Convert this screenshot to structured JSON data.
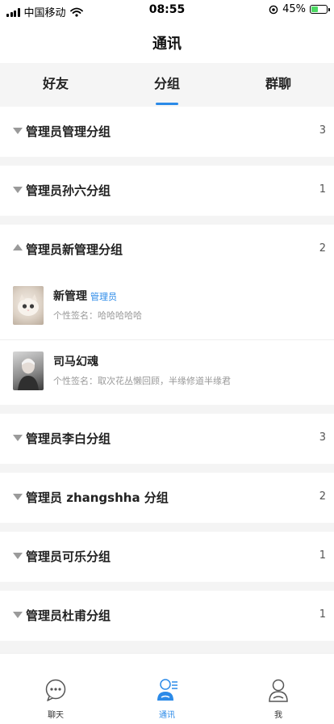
{
  "status_bar": {
    "carrier": "中国移动",
    "time": "08:55",
    "battery": "45%",
    "battery_level": 0.45,
    "icons": [
      "signal-icon",
      "wifi-icon",
      "location-icon",
      "battery-icon"
    ]
  },
  "header": {
    "title": "通讯"
  },
  "tabs": [
    {
      "label": "好友",
      "active": false
    },
    {
      "label": "分组",
      "active": true
    },
    {
      "label": "群聊",
      "active": false
    }
  ],
  "groups": [
    {
      "name": "管理员管理分组",
      "count": "3",
      "expanded": false
    },
    {
      "name": "管理员孙六分组",
      "count": "1",
      "expanded": false
    },
    {
      "name": "管理员新管理分组",
      "count": "2",
      "expanded": true,
      "members": [
        {
          "name": "新管理",
          "badge": "管理员",
          "signature": "个性签名：哈哈哈哈哈"
        },
        {
          "name": "司马幻魂",
          "badge": "",
          "signature": "个性签名：取次花丛懒回顾，半缘修道半缘君"
        }
      ]
    },
    {
      "name": "管理员李白分组",
      "count": "3",
      "expanded": false
    },
    {
      "name": "管理员 zhangshha 分组",
      "count": "2",
      "expanded": false
    },
    {
      "name": "管理员可乐分组",
      "count": "1",
      "expanded": false
    },
    {
      "name": "管理员杜甫分组",
      "count": "1",
      "expanded": false
    }
  ],
  "tab_bar": [
    {
      "label": "聊天",
      "icon": "chat-icon",
      "active": false
    },
    {
      "label": "通讯",
      "icon": "contacts-icon",
      "active": true
    },
    {
      "label": "我",
      "icon": "profile-icon",
      "active": false
    }
  ],
  "colors": {
    "accent": "#2b8ae8",
    "background": "#f4f4f4",
    "arrow": "#9a9a9a"
  }
}
